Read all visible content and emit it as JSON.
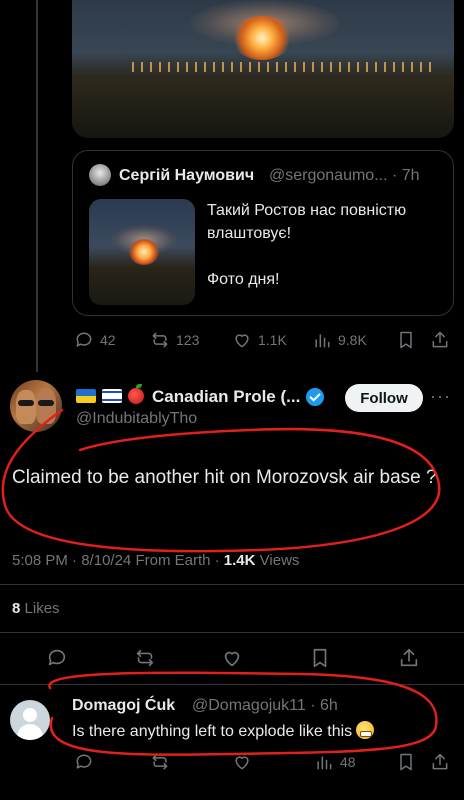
{
  "quoted": {
    "author_name": "Сергій Наумович",
    "author_handle": "@sergonaumo...",
    "time": "7h",
    "text": "Такий Ростов нас повністю влаштовує!\n\nФото дня!",
    "stats": {
      "replies": "42",
      "reposts": "123",
      "likes": "1.1K",
      "views": "9.8K"
    }
  },
  "main_tweet": {
    "author_name": "Canadian Prole (...",
    "author_handle": "@IndubitablyTho",
    "follow_label": "Follow",
    "more_label": "···",
    "text": "Claimed to be another hit on Morozovsk air base ?",
    "time": "5:08 PM",
    "date": "8/10/24",
    "source": "From Earth",
    "views_count": "1.4K",
    "views_label": "Views",
    "likes_count": "8",
    "likes_label": "Likes"
  },
  "reply": {
    "author_name": "Domagoj Ćuk",
    "author_handle": "@Domagojuk11",
    "time": "6h",
    "text": "Is there anything left to explode like this",
    "stats": {
      "views": "48"
    }
  },
  "icons": [
    "reply-icon",
    "repost-icon",
    "like-icon",
    "views-icon",
    "bookmark-icon",
    "share-icon",
    "verified-badge-icon",
    "flag-ukraine-icon",
    "flag-israel-icon",
    "apple-icon",
    "grimace-emoji-icon"
  ],
  "colors": {
    "background": "#000000",
    "text": "#e7e9ea",
    "muted": "#71767b",
    "verified": "#1d9bf0",
    "annotation": "#e0201a"
  }
}
